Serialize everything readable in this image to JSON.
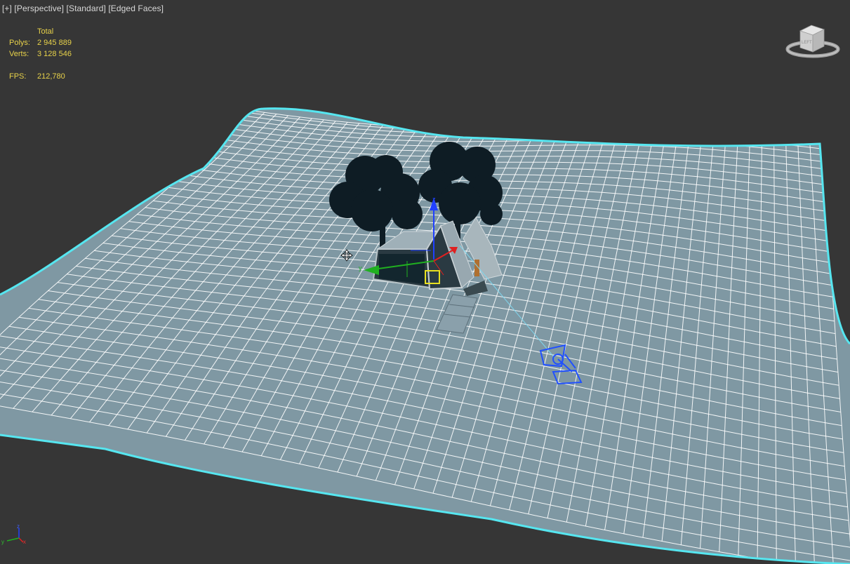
{
  "viewport": {
    "labels": {
      "plus": "[+]",
      "view": "[Perspective]",
      "shading": "[Standard]",
      "edges": "[Edged Faces]"
    },
    "stats": {
      "header": "Total",
      "polys_label": "Polys:",
      "polys_value": "2 945 889",
      "verts_label": "Verts:",
      "verts_value": "3 128 546",
      "fps_label": "FPS:",
      "fps_value": "212,780"
    },
    "viewcube": {
      "face_label": "LEFT",
      "icon": "viewcube-icon"
    },
    "axis_tripod": {
      "x": "x",
      "y": "y",
      "z": "z",
      "icon": "axis-tripod-icon"
    }
  },
  "colors": {
    "background": "#363636",
    "terrain_fill": "#7f98a3",
    "terrain_grid": "#ffffff",
    "selection_outline": "#56e6f0",
    "stats_text": "#e8d24a",
    "gizmo_x": "#e02020",
    "gizmo_y": "#20b020",
    "gizmo_z": "#2040ff",
    "light_object": "#2050ff",
    "tree": "#0e1c24"
  },
  "scene": {
    "objects": [
      "terrain-plane",
      "house",
      "trees",
      "path",
      "light-helper",
      "transform-gizmo"
    ]
  }
}
